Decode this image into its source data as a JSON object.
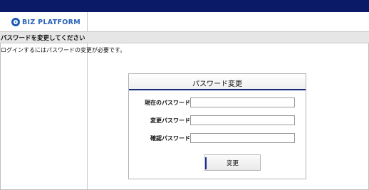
{
  "header": {
    "logo_text": "BIZ PLATFORM"
  },
  "page": {
    "title": "パスワードを変更してください",
    "notice": "ログインするにはパスワードの変更が必要です。"
  },
  "dialog": {
    "title": "パスワード変更",
    "fields": [
      {
        "label": "現在のパスワード",
        "value": ""
      },
      {
        "label": "変更パスワード",
        "value": ""
      },
      {
        "label": "確認パスワード",
        "value": ""
      }
    ],
    "submit_label": "変更"
  },
  "colors": {
    "top_bar": "#0a1a66",
    "logo_blue": "#2a63b8",
    "accent_line": "#1a2a7a"
  }
}
